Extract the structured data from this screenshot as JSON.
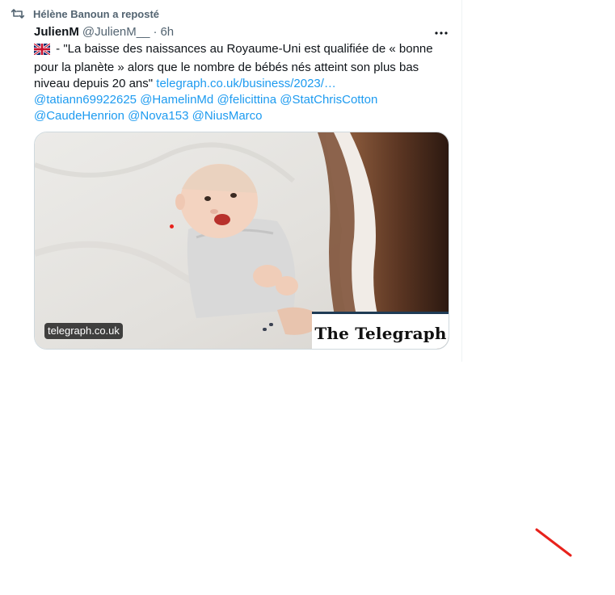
{
  "repost": {
    "label": "Hélène Banoun a reposté",
    "icon": "repost-icon"
  },
  "tweet": {
    "display_name": "JulienM",
    "handle": "@JulienM__",
    "separator": "·",
    "time": "6h",
    "more_icon": "more-dots-icon",
    "flag": "uk-flag-icon",
    "text_main": " - \"La baisse des naissances au Royaume-Uni est qualifiée de « bonne pour la planète » alors que le nombre de bébés nés atteint son plus bas niveau depuis 20 ans\" ",
    "link": "telegraph.co.uk/business/2023/…",
    "mentions": [
      "@tatiann69922625",
      "@HamelinMd",
      "@felicittina",
      "@StatChrisCotton",
      "@CaudeHenrion",
      "@Nova153",
      "@NiusMarco"
    ]
  },
  "card": {
    "domain": "telegraph.co.uk",
    "logo_text": "The Telegraph"
  },
  "colors": {
    "link": "#1d9bf0",
    "secondary": "#536471",
    "annotation": "#e8221c"
  }
}
